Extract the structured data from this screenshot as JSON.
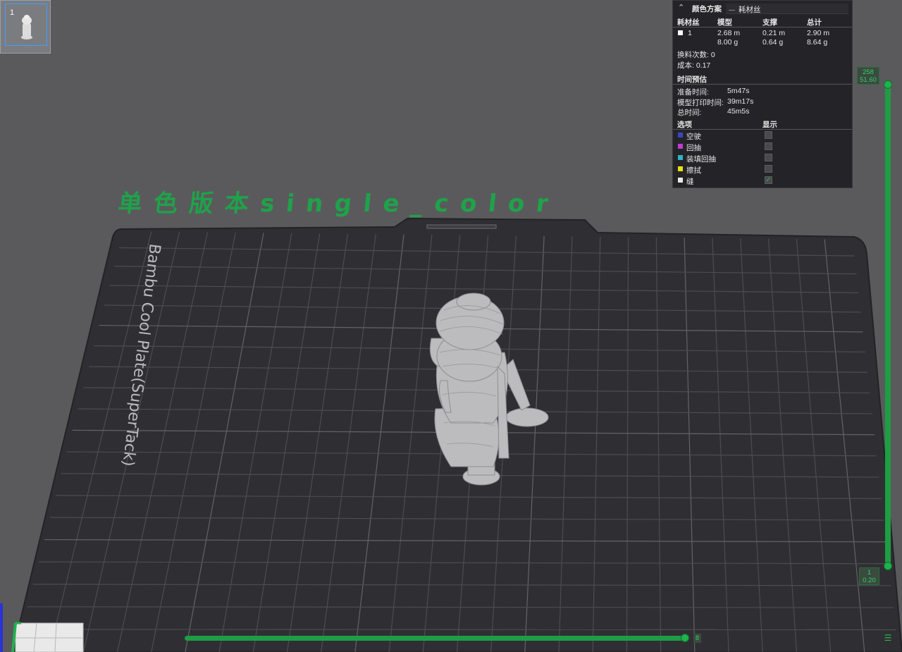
{
  "plate_thumbnail": {
    "index": "1"
  },
  "legend": {
    "scheme_label": "颜色方案",
    "scheme_value": "耗材丝",
    "columns": [
      "耗材丝",
      "模型",
      "支撑",
      "总计"
    ],
    "filament_rows": [
      {
        "id": "1",
        "swatch_color": "#ffffff",
        "model_len": "2.68 m",
        "model_wt": "8.00 g",
        "support_len": "0.21 m",
        "support_wt": "0.64 g",
        "total_len": "2.90 m",
        "total_wt": "8.64 g"
      }
    ],
    "changes": "换料次数: 0",
    "cost": "成本: 0.17",
    "time_section": "时间预估",
    "time_rows": [
      {
        "label": "准备时间:",
        "value": "5m47s"
      },
      {
        "label": "模型打印时间:",
        "value": "39m17s"
      },
      {
        "label": "总时间:",
        "value": "45m5s"
      }
    ],
    "options_header": "选项",
    "show_header": "显示",
    "options": [
      {
        "label": "空驶",
        "color": "#3a45c4",
        "checked": false
      },
      {
        "label": "回抽",
        "color": "#c23bd1",
        "checked": false
      },
      {
        "label": "装填回抽",
        "color": "#2fb4c9",
        "checked": false
      },
      {
        "label": "擦拭",
        "color": "#e8e019",
        "checked": false
      },
      {
        "label": "缝",
        "color": "#e8e8e8",
        "checked": true
      }
    ]
  },
  "viewport": {
    "plate_title": "单色版本single_color",
    "plate_name": "Bambu Cool Plate(SuperTack)",
    "plate_color": "#2f2f33",
    "grid_color": "#4c4c51",
    "title_color": "#1fa24a"
  },
  "layer_slider": {
    "top_layer": "258",
    "top_height": "51.60",
    "bottom_layer": "1",
    "bottom_height": "0.20",
    "accent": "#1f9d44"
  },
  "move_slider": {
    "value": "8"
  },
  "icons": {
    "layers": "layers-icon",
    "collapse": "chevron-up-icon",
    "dropdown": "chevron-down-icon"
  }
}
